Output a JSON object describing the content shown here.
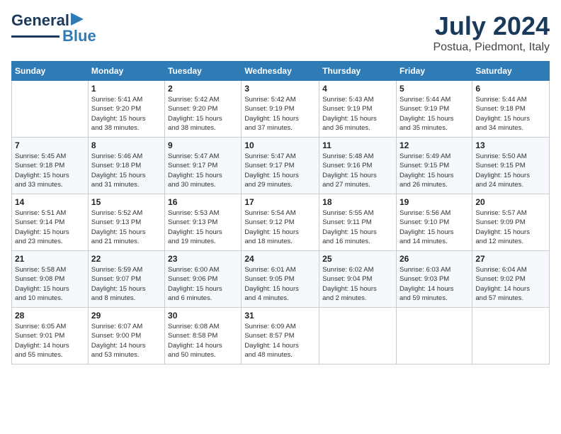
{
  "header": {
    "logo_line1": "General",
    "logo_line2": "Blue",
    "month": "July 2024",
    "location": "Postua, Piedmont, Italy"
  },
  "calendar": {
    "days_of_week": [
      "Sunday",
      "Monday",
      "Tuesday",
      "Wednesday",
      "Thursday",
      "Friday",
      "Saturday"
    ],
    "weeks": [
      [
        {
          "day": "",
          "info": ""
        },
        {
          "day": "1",
          "info": "Sunrise: 5:41 AM\nSunset: 9:20 PM\nDaylight: 15 hours\nand 38 minutes."
        },
        {
          "day": "2",
          "info": "Sunrise: 5:42 AM\nSunset: 9:20 PM\nDaylight: 15 hours\nand 38 minutes."
        },
        {
          "day": "3",
          "info": "Sunrise: 5:42 AM\nSunset: 9:19 PM\nDaylight: 15 hours\nand 37 minutes."
        },
        {
          "day": "4",
          "info": "Sunrise: 5:43 AM\nSunset: 9:19 PM\nDaylight: 15 hours\nand 36 minutes."
        },
        {
          "day": "5",
          "info": "Sunrise: 5:44 AM\nSunset: 9:19 PM\nDaylight: 15 hours\nand 35 minutes."
        },
        {
          "day": "6",
          "info": "Sunrise: 5:44 AM\nSunset: 9:18 PM\nDaylight: 15 hours\nand 34 minutes."
        }
      ],
      [
        {
          "day": "7",
          "info": "Sunrise: 5:45 AM\nSunset: 9:18 PM\nDaylight: 15 hours\nand 33 minutes."
        },
        {
          "day": "8",
          "info": "Sunrise: 5:46 AM\nSunset: 9:18 PM\nDaylight: 15 hours\nand 31 minutes."
        },
        {
          "day": "9",
          "info": "Sunrise: 5:47 AM\nSunset: 9:17 PM\nDaylight: 15 hours\nand 30 minutes."
        },
        {
          "day": "10",
          "info": "Sunrise: 5:47 AM\nSunset: 9:17 PM\nDaylight: 15 hours\nand 29 minutes."
        },
        {
          "day": "11",
          "info": "Sunrise: 5:48 AM\nSunset: 9:16 PM\nDaylight: 15 hours\nand 27 minutes."
        },
        {
          "day": "12",
          "info": "Sunrise: 5:49 AM\nSunset: 9:15 PM\nDaylight: 15 hours\nand 26 minutes."
        },
        {
          "day": "13",
          "info": "Sunrise: 5:50 AM\nSunset: 9:15 PM\nDaylight: 15 hours\nand 24 minutes."
        }
      ],
      [
        {
          "day": "14",
          "info": "Sunrise: 5:51 AM\nSunset: 9:14 PM\nDaylight: 15 hours\nand 23 minutes."
        },
        {
          "day": "15",
          "info": "Sunrise: 5:52 AM\nSunset: 9:13 PM\nDaylight: 15 hours\nand 21 minutes."
        },
        {
          "day": "16",
          "info": "Sunrise: 5:53 AM\nSunset: 9:13 PM\nDaylight: 15 hours\nand 19 minutes."
        },
        {
          "day": "17",
          "info": "Sunrise: 5:54 AM\nSunset: 9:12 PM\nDaylight: 15 hours\nand 18 minutes."
        },
        {
          "day": "18",
          "info": "Sunrise: 5:55 AM\nSunset: 9:11 PM\nDaylight: 15 hours\nand 16 minutes."
        },
        {
          "day": "19",
          "info": "Sunrise: 5:56 AM\nSunset: 9:10 PM\nDaylight: 15 hours\nand 14 minutes."
        },
        {
          "day": "20",
          "info": "Sunrise: 5:57 AM\nSunset: 9:09 PM\nDaylight: 15 hours\nand 12 minutes."
        }
      ],
      [
        {
          "day": "21",
          "info": "Sunrise: 5:58 AM\nSunset: 9:08 PM\nDaylight: 15 hours\nand 10 minutes."
        },
        {
          "day": "22",
          "info": "Sunrise: 5:59 AM\nSunset: 9:07 PM\nDaylight: 15 hours\nand 8 minutes."
        },
        {
          "day": "23",
          "info": "Sunrise: 6:00 AM\nSunset: 9:06 PM\nDaylight: 15 hours\nand 6 minutes."
        },
        {
          "day": "24",
          "info": "Sunrise: 6:01 AM\nSunset: 9:05 PM\nDaylight: 15 hours\nand 4 minutes."
        },
        {
          "day": "25",
          "info": "Sunrise: 6:02 AM\nSunset: 9:04 PM\nDaylight: 15 hours\nand 2 minutes."
        },
        {
          "day": "26",
          "info": "Sunrise: 6:03 AM\nSunset: 9:03 PM\nDaylight: 14 hours\nand 59 minutes."
        },
        {
          "day": "27",
          "info": "Sunrise: 6:04 AM\nSunset: 9:02 PM\nDaylight: 14 hours\nand 57 minutes."
        }
      ],
      [
        {
          "day": "28",
          "info": "Sunrise: 6:05 AM\nSunset: 9:01 PM\nDaylight: 14 hours\nand 55 minutes."
        },
        {
          "day": "29",
          "info": "Sunrise: 6:07 AM\nSunset: 9:00 PM\nDaylight: 14 hours\nand 53 minutes."
        },
        {
          "day": "30",
          "info": "Sunrise: 6:08 AM\nSunset: 8:58 PM\nDaylight: 14 hours\nand 50 minutes."
        },
        {
          "day": "31",
          "info": "Sunrise: 6:09 AM\nSunset: 8:57 PM\nDaylight: 14 hours\nand 48 minutes."
        },
        {
          "day": "",
          "info": ""
        },
        {
          "day": "",
          "info": ""
        },
        {
          "day": "",
          "info": ""
        }
      ]
    ]
  }
}
